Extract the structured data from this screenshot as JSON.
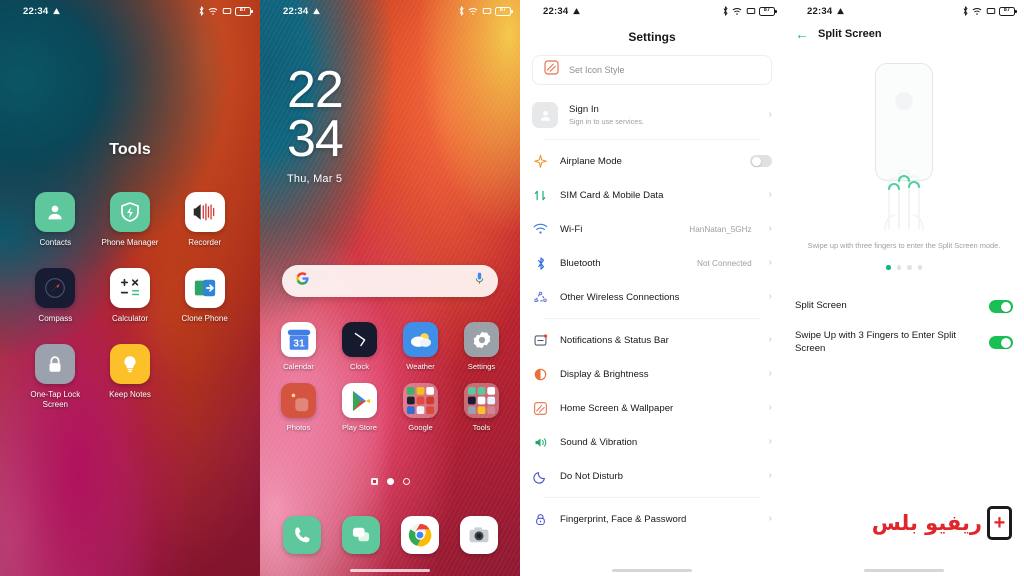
{
  "status_bar": {
    "time": "22:34",
    "left_icons": [
      "drive-icon"
    ],
    "right_icons": [
      "bluetooth-icon",
      "wifi-icon",
      "vibrate-icon",
      "battery-icon"
    ],
    "battery_text": "87"
  },
  "panel1": {
    "name": "folder-overlay",
    "folder_title": "Tools",
    "apps": [
      {
        "label": "Contacts",
        "icon": "contacts-icon"
      },
      {
        "label": "Phone Manager",
        "icon": "shield-icon"
      },
      {
        "label": "Recorder",
        "icon": "recorder-icon"
      },
      {
        "label": "Compass",
        "icon": "compass-icon"
      },
      {
        "label": "Calculator",
        "icon": "calculator-icon"
      },
      {
        "label": "Clone Phone",
        "icon": "clone-phone-icon"
      },
      {
        "label": "One-Tap Lock Screen",
        "icon": "lock-icon"
      },
      {
        "label": "Keep Notes",
        "icon": "lightbulb-icon"
      }
    ]
  },
  "panel2": {
    "name": "home-screen",
    "clock": {
      "hours": "22",
      "minutes": "34",
      "date": "Thu, Mar 5"
    },
    "search": {
      "placeholder": "",
      "value": "",
      "left_icon": "google-g-icon",
      "right_icon": "microphone-icon"
    },
    "apps": [
      {
        "label": "Calendar",
        "icon": "calendar-icon",
        "badge": "31"
      },
      {
        "label": "Clock",
        "icon": "clock-icon"
      },
      {
        "label": "Weather",
        "icon": "weather-icon"
      },
      {
        "label": "Settings",
        "icon": "settings-gear-icon"
      },
      {
        "label": "Photos",
        "icon": "photos-icon"
      },
      {
        "label": "Play Store",
        "icon": "play-store-icon"
      },
      {
        "label": "Google",
        "icon": "folder-icon"
      },
      {
        "label": "Tools",
        "icon": "folder-icon"
      }
    ],
    "page_indicators": [
      "square",
      "dot-active",
      "ring"
    ],
    "dock": [
      {
        "label": "Phone",
        "icon": "phone-icon"
      },
      {
        "label": "Messages",
        "icon": "messages-icon"
      },
      {
        "label": "Chrome",
        "icon": "chrome-icon"
      },
      {
        "label": "Camera",
        "icon": "camera-icon"
      }
    ]
  },
  "panel3": {
    "name": "settings-screen",
    "title": "Settings",
    "icon_style_card": {
      "label": "Set Icon Style",
      "icon": "icon-style-icon"
    },
    "sign_in": {
      "label": "Sign In",
      "sub": "Sign in to use services.",
      "icon": "account-avatar-icon"
    },
    "rows": [
      {
        "label": "Airplane Mode",
        "icon": "airplane-icon",
        "control": "toggle",
        "toggle_on": false
      },
      {
        "label": "SIM Card & Mobile Data",
        "icon": "sim-card-icon",
        "control": "chevron",
        "value": ""
      },
      {
        "label": "Wi-Fi",
        "icon": "wifi-icon",
        "control": "chevron",
        "value": "HanNatan_5GHz"
      },
      {
        "label": "Bluetooth",
        "icon": "bluetooth-icon",
        "control": "chevron",
        "value": "Not Connected"
      },
      {
        "label": "Other Wireless Connections",
        "icon": "other-wireless-icon",
        "control": "chevron",
        "value": ""
      },
      {
        "label": "Notifications & Status Bar",
        "icon": "notifications-icon",
        "control": "chevron",
        "value": ""
      },
      {
        "label": "Display & Brightness",
        "icon": "display-icon",
        "control": "chevron",
        "value": ""
      },
      {
        "label": "Home Screen & Wallpaper",
        "icon": "wallpaper-icon",
        "control": "chevron",
        "value": ""
      },
      {
        "label": "Sound & Vibration",
        "icon": "sound-icon",
        "control": "chevron",
        "value": ""
      },
      {
        "label": "Do Not Disturb",
        "icon": "moon-icon",
        "control": "chevron",
        "value": ""
      },
      {
        "label": "Fingerprint, Face & Password",
        "icon": "fingerprint-lock-icon",
        "control": "chevron",
        "value": ""
      }
    ]
  },
  "panel4": {
    "name": "split-screen-screen",
    "title": "Split Screen",
    "back_icon": "back-arrow-icon",
    "hint": "Swipe up with three fingers to enter the Split Screen mode.",
    "carousel": {
      "count": 4,
      "active_index": 0
    },
    "rows": [
      {
        "label": "Split Screen",
        "toggle_on": true
      },
      {
        "label": "Swipe Up with 3 Fingers to Enter Split Screen",
        "toggle_on": true
      }
    ]
  },
  "watermark": {
    "text": "ريفيو بلس",
    "plus": "+",
    "color": "#e0262b"
  }
}
